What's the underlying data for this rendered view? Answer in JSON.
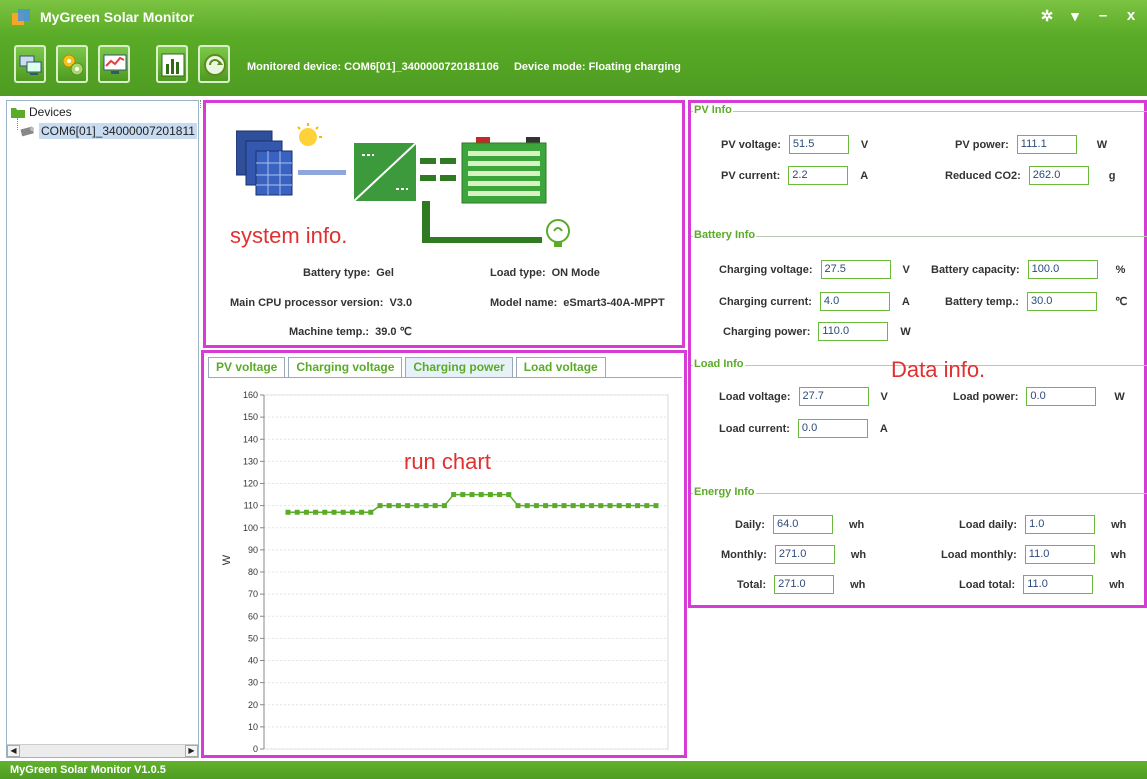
{
  "app": {
    "title": "MyGreen Solar Monitor",
    "status_version": "MyGreen Solar Monitor V1.0.5"
  },
  "window_controls": {
    "settings_icon": "gear-icon",
    "pin_icon": "pin-icon",
    "minimize": "–",
    "close": "x"
  },
  "toolbar": {
    "buttons": [
      "connect-devices",
      "settings",
      "monitor",
      "chart",
      "refresh"
    ],
    "monitored_device": "Monitored device: COM6[01]_3400000720181106",
    "device_mode": "Device mode: Floating charging"
  },
  "tree": {
    "root": "Devices",
    "child": "COM6[01]_34000007201811"
  },
  "system_info": {
    "caption": "system info.",
    "battery_type_label": "Battery type:",
    "battery_type": "Gel",
    "load_type_label": "Load type:",
    "load_type": "ON Mode",
    "cpu_version_label": "Main CPU processor version:",
    "cpu_version": "V3.0",
    "model_name_label": "Model name:",
    "model_name": "eSmart3-40A-MPPT",
    "machine_temp_label": "Machine temp.:",
    "machine_temp": "39.0 ℃"
  },
  "chart_tabs": [
    "PV voltage",
    "Charging voltage",
    "Charging power",
    "Load voltage"
  ],
  "active_tab": 2,
  "chart_caption": "run chart",
  "chart_data": {
    "type": "line",
    "ylabel": "W",
    "ylim": [
      0,
      160
    ],
    "yticks": [
      0,
      10,
      20,
      30,
      40,
      50,
      60,
      70,
      80,
      90,
      100,
      110,
      120,
      130,
      140,
      150,
      160
    ],
    "grid": true,
    "color": "#5aab27",
    "series": [
      {
        "values": [
          107,
          107,
          107,
          107,
          107,
          107,
          107,
          107,
          107,
          107,
          110,
          110,
          110,
          110,
          110,
          110,
          110,
          110,
          115,
          115,
          115,
          115,
          115,
          115,
          115,
          110,
          110,
          110,
          110,
          110,
          110,
          110,
          110,
          110,
          110,
          110,
          110,
          110,
          110,
          110,
          110
        ]
      }
    ]
  },
  "data_caption": "Data info.",
  "pv_info": {
    "title": "PV Info",
    "pv_voltage_label": "PV voltage:",
    "pv_voltage": "51.5",
    "pv_voltage_unit": "V",
    "pv_power_label": "PV power:",
    "pv_power": "111.1",
    "pv_power_unit": "W",
    "pv_current_label": "PV current:",
    "pv_current": "2.2",
    "pv_current_unit": "A",
    "co2_label": "Reduced CO2:",
    "co2": "262.0",
    "co2_unit": "g"
  },
  "battery_info": {
    "title": "Battery Info",
    "charging_voltage_label": "Charging voltage:",
    "charging_voltage": "27.5",
    "charging_voltage_unit": "V",
    "capacity_label": "Battery capacity:",
    "capacity": "100.0",
    "capacity_unit": "%",
    "charging_current_label": "Charging current:",
    "charging_current": "4.0",
    "charging_current_unit": "A",
    "temp_label": "Battery temp.:",
    "temp": "30.0",
    "temp_unit": "℃",
    "charging_power_label": "Charging power:",
    "charging_power": "110.0",
    "charging_power_unit": "W"
  },
  "load_info": {
    "title": "Load Info",
    "load_voltage_label": "Load voltage:",
    "load_voltage": "27.7",
    "load_voltage_unit": "V",
    "load_power_label": "Load power:",
    "load_power": "0.0",
    "load_power_unit": "W",
    "load_current_label": "Load current:",
    "load_current": "0.0",
    "load_current_unit": "A"
  },
  "energy_info": {
    "title": "Energy Info",
    "daily_label": "Daily:",
    "daily": "64.0",
    "daily_unit": "wh",
    "load_daily_label": "Load daily:",
    "load_daily": "1.0",
    "load_daily_unit": "wh",
    "monthly_label": "Monthly:",
    "monthly": "271.0",
    "monthly_unit": "wh",
    "load_monthly_label": "Load monthly:",
    "load_monthly": "11.0",
    "load_monthly_unit": "wh",
    "total_label": "Total:",
    "total": "271.0",
    "total_unit": "wh",
    "load_total_label": "Load total:",
    "load_total": "11.0",
    "load_total_unit": "wh"
  }
}
